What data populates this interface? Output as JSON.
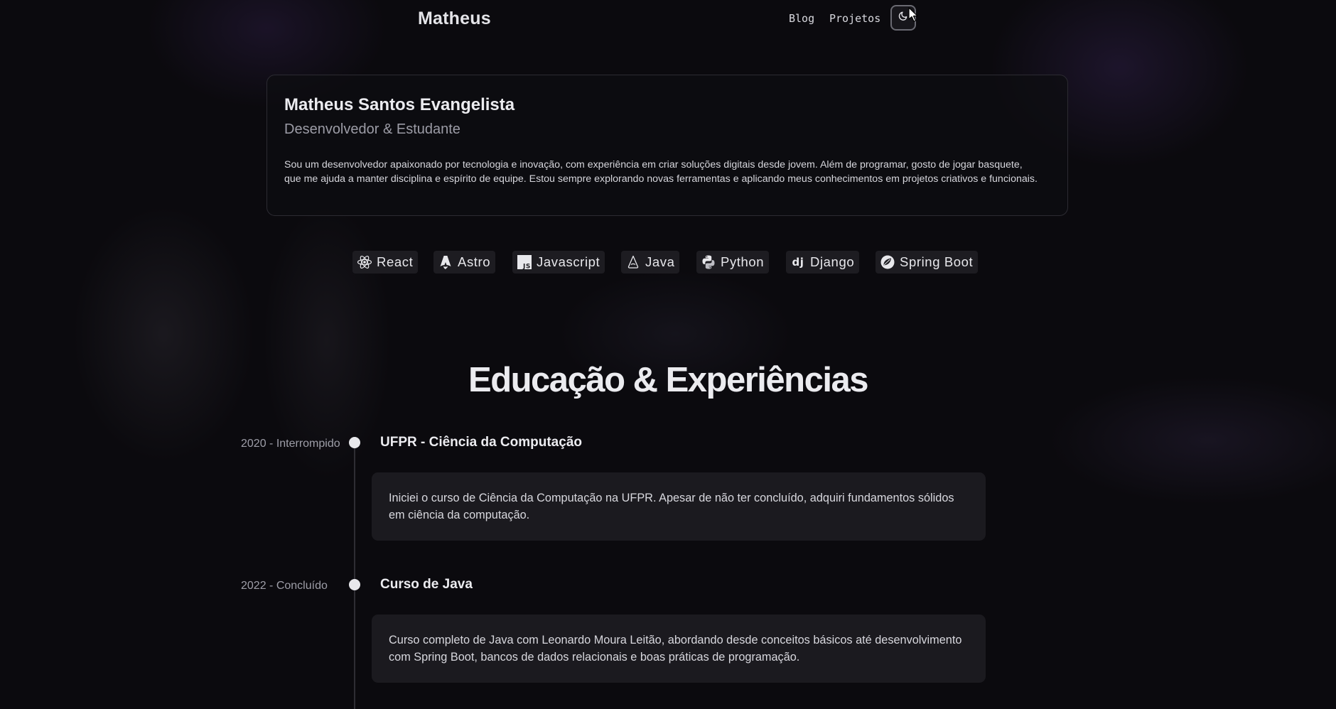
{
  "header": {
    "brand": "Matheus",
    "nav": [
      {
        "label": "Blog"
      },
      {
        "label": "Projetos"
      }
    ],
    "theme_toggle_icon": "moon-icon"
  },
  "profile": {
    "name": "Matheus Santos Evangelista",
    "role": "Desenvolvedor & Estudante",
    "bio": "Sou um desenvolvedor apaixonado por tecnologia e inovação, com experiência em criar soluções digitais desde jovem. Além de programar, gosto de jogar basquete, que me ajuda a manter disciplina e espírito de equipe. Estou sempre explorando novas ferramentas e aplicando meus conhecimentos em projetos criativos e funcionais."
  },
  "technologies": [
    {
      "label": "React",
      "icon": "react-icon"
    },
    {
      "label": "Astro",
      "icon": "astro-icon"
    },
    {
      "label": "Javascript",
      "icon": "javascript-icon"
    },
    {
      "label": "Java",
      "icon": "java-icon"
    },
    {
      "label": "Python",
      "icon": "python-icon"
    },
    {
      "label": "Django",
      "icon": "django-icon"
    },
    {
      "label": "Spring Boot",
      "icon": "spring-boot-icon"
    }
  ],
  "timeline": {
    "title": "Educação & Experiências",
    "items": [
      {
        "date": "2020 - Interrompido",
        "title": "UFPR - Ciência da Computação",
        "description": "Iniciei o curso de Ciência da Computação na UFPR. Apesar de não ter concluído, adquiri fundamentos sólidos em ciência da computação."
      },
      {
        "date": "2022 - Concluído",
        "title": "Curso de Java",
        "description": "Curso completo de Java com Leonardo Moura Leitão, abordando desde conceitos básicos até desenvolvimento com Spring Boot, bancos de dados relacionais e boas práticas de programação."
      }
    ]
  },
  "colors": {
    "background": "#0b0a0e",
    "card_border": "#2c2b32",
    "chip_bg": "#1d1c21",
    "box_bg": "#1b1a1f",
    "text": "#ececf0",
    "muted": "#9e9ea8"
  }
}
